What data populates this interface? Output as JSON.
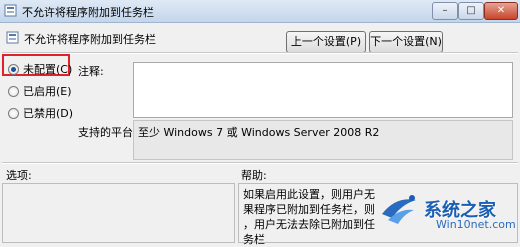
{
  "window": {
    "title": "不允许将程序附加到任务栏",
    "minimize_glyph": "–",
    "maximize_glyph": "□",
    "close_glyph": "✕"
  },
  "header": {
    "policy_name": "不允许将程序附加到任务栏",
    "prev_button": "上一个设置(P)",
    "next_button": "下一个设置(N)"
  },
  "options": [
    {
      "label": "未配置(C)",
      "selected": true
    },
    {
      "label": "已启用(E)",
      "selected": false
    },
    {
      "label": "已禁用(D)",
      "selected": false
    }
  ],
  "comment": {
    "label": "注释:",
    "value": ""
  },
  "supported": {
    "label": "支持的平台:",
    "value": "至少 Windows 7 或 Windows Server 2008 R2"
  },
  "sections": {
    "options_label": "选项:",
    "help_label": "帮助:"
  },
  "help_lines": [
    "如果启用此设置，则用户无",
    "果程序已附加到任务栏，则",
    "，用户无法去除已附加到任",
    "务栏"
  ],
  "watermark": {
    "title": "系统之家",
    "url": "Win10net.com"
  },
  "colors": {
    "highlight_border": "#e0202b",
    "selected_radio": "#1f4f9f",
    "watermark": "#1a5fb4"
  }
}
